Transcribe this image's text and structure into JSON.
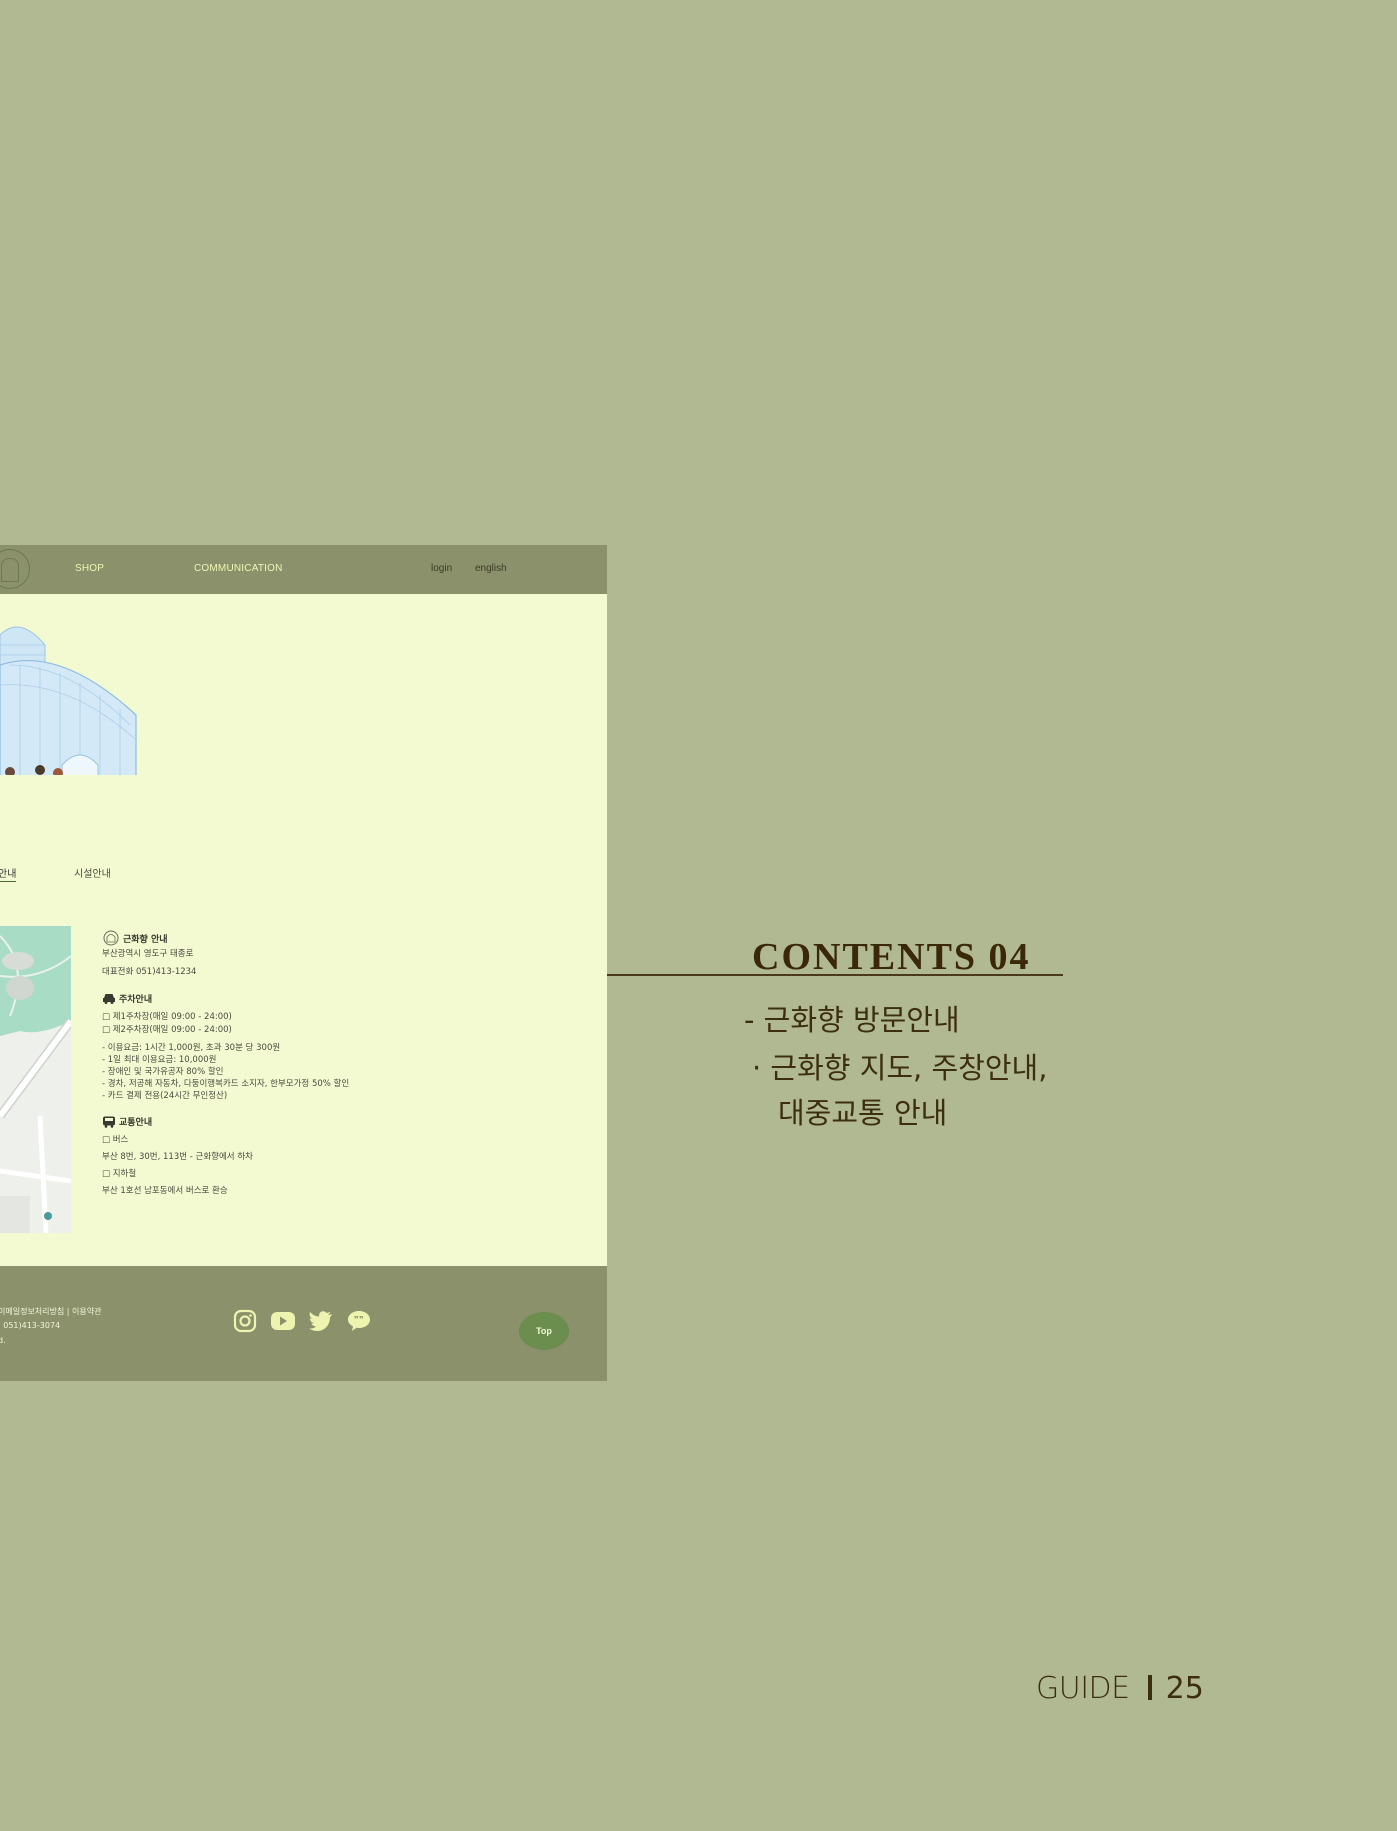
{
  "site": {
    "nav": {
      "shop": "SHOP",
      "communication": "COMMUNICATION",
      "login": "login",
      "english": "english"
    },
    "tabs": {
      "active": "안내",
      "facility": "시설안내"
    },
    "info": {
      "location": {
        "title": "근화향 안내",
        "address": "부산광역시 영도구 태종로",
        "phone": "대표전화 051)413-1234"
      },
      "parking": {
        "title": "주차안내",
        "lot1": "□ 제1주차장(매일 09:00 - 24:00)",
        "lot2": "□ 제2주차장(매일 09:00 - 24:00)",
        "details": [
          "- 이용요금: 1시간 1,000원, 초과 30분 당 300원",
          "- 1일 최대 이용요금: 10,000원",
          "- 장애인 및 국가유공자 80% 할인",
          "- 경차, 저공해 자동차, 다둥이행복카드 소지자, 한부모가정 50% 할인",
          "- 카드 결제 전용(24시간 무인정산)"
        ]
      },
      "transit": {
        "title": "교통안내",
        "bus_label": "□ 버스",
        "bus": "부산 8번, 30번, 113번 - 근화향에서 하차",
        "subway_label": "□ 지하철",
        "subway": "부산 1호선 남포동에서 버스로 환승"
      }
    },
    "footer": {
      "links": "이메일정보처리방침   |  이용약관",
      "contact": "| 051)413-3074",
      "copyright": "d.",
      "top_button": "Top"
    },
    "icons": [
      "instagram-icon",
      "youtube-icon",
      "twitter-icon",
      "kakaotalk-icon"
    ]
  },
  "annotation": {
    "title": "CONTENTS 04",
    "bullet1": "- 근화향 방문안내",
    "bullet2": "· 근화향 지도, 주창안내,",
    "bullet3": "대중교통 안내"
  },
  "page_footer": {
    "label": "GUIDE",
    "number": "25"
  },
  "colors": {
    "page_bg": "#b0b992",
    "site_bg": "#f3fad2",
    "header_bg": "#8a916b",
    "top_button": "#6b8d4e",
    "text_dark": "#3d2e12"
  }
}
